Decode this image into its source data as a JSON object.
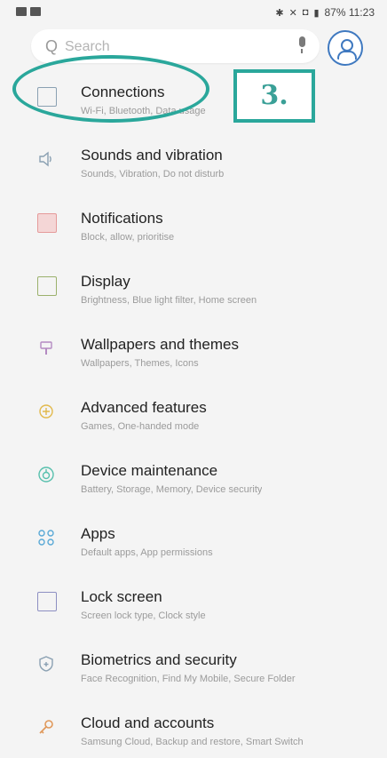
{
  "status_bar": {
    "right_text": "87% 11:23"
  },
  "search": {
    "placeholder": "Search"
  },
  "settings_items": [
    {
      "title": "Connections",
      "subtitle": "Wi-Fi, Bluetooth, Data usage",
      "icon": "connections-icon"
    },
    {
      "title": "Sounds and vibration",
      "subtitle": "Sounds, Vibration, Do not disturb",
      "icon": "speaker-icon"
    },
    {
      "title": "Notifications",
      "subtitle": "Block, allow, prioritise",
      "icon": "notifications-icon"
    },
    {
      "title": "Display",
      "subtitle": "Brightness, Blue light filter, Home screen",
      "icon": "display-icon"
    },
    {
      "title": "Wallpapers and themes",
      "subtitle": "Wallpapers, Themes, Icons",
      "icon": "paintbrush-icon"
    },
    {
      "title": "Advanced features",
      "subtitle": "Games, One-handed mode",
      "icon": "gear-plus-icon"
    },
    {
      "title": "Device maintenance",
      "subtitle": "Battery, Storage, Memory, Device security",
      "icon": "maintenance-icon"
    },
    {
      "title": "Apps",
      "subtitle": "Default apps, App permissions",
      "icon": "apps-grid-icon"
    },
    {
      "title": "Lock screen",
      "subtitle": "Screen lock type, Clock style",
      "icon": "lock-screen-icon"
    },
    {
      "title": "Biometrics and security",
      "subtitle": "Face Recognition, Find My Mobile, Secure Folder",
      "icon": "shield-icon"
    },
    {
      "title": "Cloud and accounts",
      "subtitle": "Samsung Cloud, Backup and restore, Smart Switch",
      "icon": "key-icon"
    }
  ],
  "annotation": {
    "step_label": "3."
  },
  "colors": {
    "annotation": "#2aa79b",
    "accent": "#3f79c0"
  }
}
